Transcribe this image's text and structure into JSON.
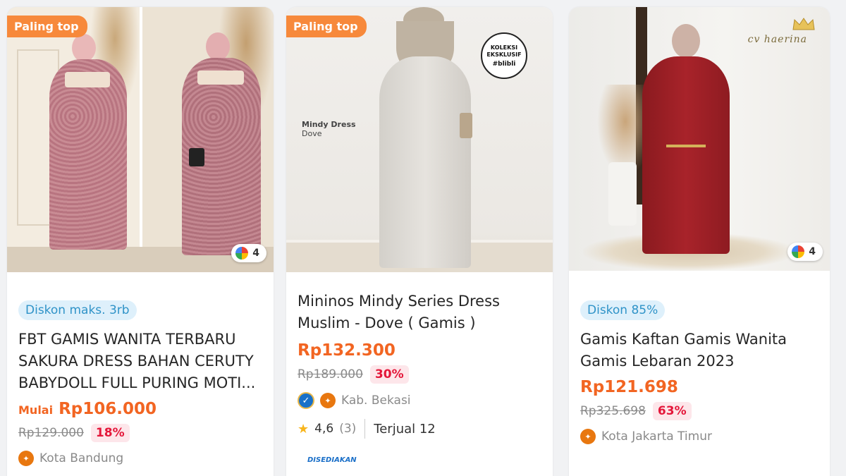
{
  "colors": {
    "accent_orange": "#f26522",
    "badge_orange": "#f7893b",
    "discount_red": "#e4173a",
    "chip_blue": "#2f93c8"
  },
  "products": [
    {
      "badge": "Paling top",
      "variant_count": "4",
      "discount_label": "Diskon maks. 3rb",
      "title": "FBT GAMIS WANITA TERBARU SAKURA DRESS BAHAN CERUTY BABYDOLL FULL PURING MOTI...",
      "price_prefix": "Mulai",
      "price": "Rp106.000",
      "old_price": "Rp129.000",
      "discount_pct": "18%",
      "location": "Kota Bandung"
    },
    {
      "badge": "Paling top",
      "image_caption_title": "Mindy Dress",
      "image_caption_sub": "Dove",
      "image_badge": "KOLEKSI EKSKLUSIF",
      "image_badge_sub": "#blibli",
      "title": "Mininos Mindy Series Dress Muslim - Dove ( Gamis )",
      "price": "Rp132.300",
      "old_price": "Rp189.000",
      "discount_pct": "30%",
      "location": "Kab. Bekasi",
      "rating": "4,6",
      "rating_count": "(3)",
      "sold": "Terjual 12",
      "service_label": "DISEDIAKAN"
    },
    {
      "image_brand": "cv haerina",
      "variant_count": "4",
      "discount_label": "Diskon 85%",
      "title": "Gamis Kaftan Gamis Wanita Gamis Lebaran 2023",
      "price": "Rp121.698",
      "old_price": "Rp325.698",
      "discount_pct": "63%",
      "location": "Kota Jakarta Timur"
    }
  ]
}
